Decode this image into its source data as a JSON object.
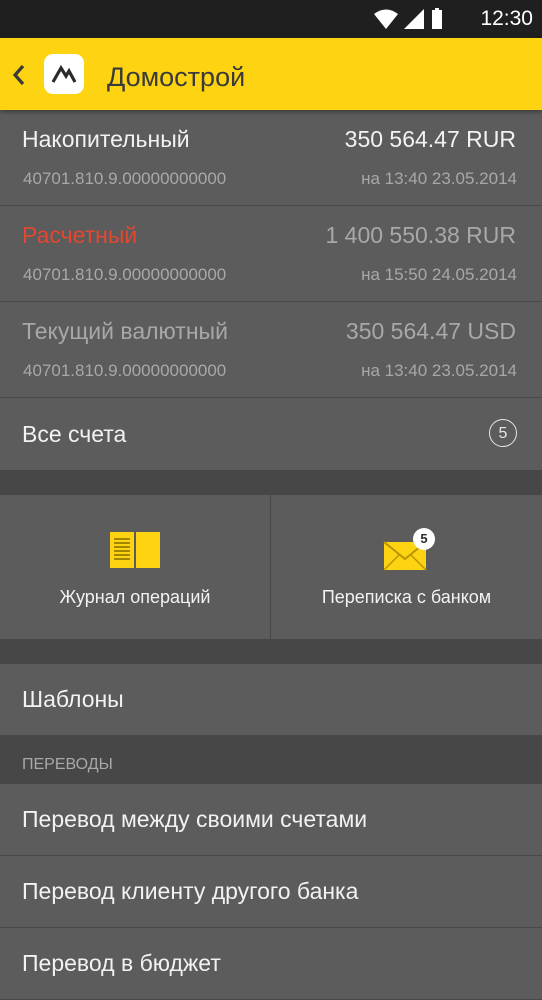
{
  "status_bar": {
    "time": "12:30",
    "icons": [
      "wifi-icon",
      "cell-signal-icon",
      "battery-icon"
    ]
  },
  "app_bar": {
    "title": "Домострой",
    "background": "#fdd312"
  },
  "accounts": [
    {
      "name": "Накопительный",
      "amount": "350 564.47 RUR",
      "number": "40701.810.9.00000000000",
      "date": "на 13:40 23.05.2014",
      "name_color": "#f2f2f2",
      "amount_color": "#f2f2f2"
    },
    {
      "name": "Расчетный",
      "amount": "1 400 550.38 RUR",
      "number": "40701.810.9.00000000000",
      "date": "на 15:50 24.05.2014",
      "name_color": "#e2472f",
      "amount_color": "#a8a8a8"
    },
    {
      "name": "Текущий валютный",
      "amount": "350 564.47 USD",
      "number": "40701.810.9.00000000000",
      "date": "на 13:40 23.05.2014",
      "name_color": "#a8a8a8",
      "amount_color": "#a8a8a8"
    }
  ],
  "all_accounts": {
    "label": "Все счета",
    "count": "5"
  },
  "tiles": [
    {
      "label": "Журнал операций",
      "icon": "book-icon"
    },
    {
      "label": "Переписка с банком",
      "icon": "envelope-icon",
      "badge": "5"
    }
  ],
  "templates": {
    "label": "Шаблоны"
  },
  "transfers": {
    "header": "ПЕРЕВОДЫ",
    "items": [
      {
        "label": "Перевод между своими счетами"
      },
      {
        "label": "Перевод клиенту другого банка"
      },
      {
        "label": "Перевод в бюджет"
      }
    ]
  },
  "colors": {
    "accent": "#fdd312",
    "background": "#5c5c5c",
    "separator": "#474747",
    "alert": "#e2472f"
  }
}
